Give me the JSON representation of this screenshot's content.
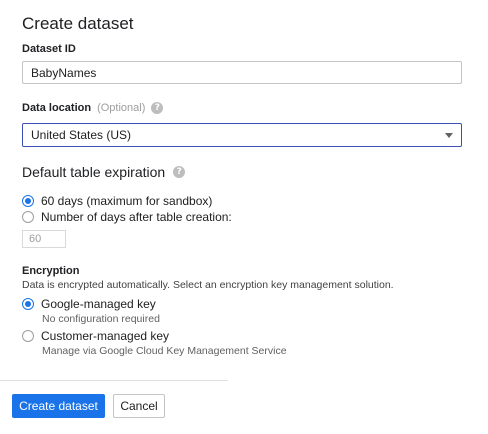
{
  "dialog": {
    "title": "Create dataset"
  },
  "dataset_id": {
    "label": "Dataset ID",
    "value": "BabyNames"
  },
  "data_location": {
    "label": "Data location",
    "optional": "(Optional)",
    "selected": "United States (US)"
  },
  "expiration": {
    "heading": "Default table expiration",
    "options": [
      {
        "label": "60 days (maximum for sandbox)",
        "checked": true
      },
      {
        "label": "Number of days after table creation:",
        "checked": false
      }
    ],
    "days_placeholder": "60"
  },
  "encryption": {
    "label": "Encryption",
    "description": "Data is encrypted automatically. Select an encryption key management solution.",
    "options": [
      {
        "label": "Google-managed key",
        "helper": "No configuration required",
        "checked": true
      },
      {
        "label": "Customer-managed key",
        "helper": "Manage via Google Cloud Key Management Service",
        "checked": false
      }
    ]
  },
  "actions": {
    "create_label": "Create dataset",
    "cancel_label": "Cancel"
  },
  "colors": {
    "primary": "#1a73e8",
    "select_border": "#3f51b5"
  },
  "icons": {
    "help": "help-icon",
    "dropdown": "chevron-down-icon"
  }
}
